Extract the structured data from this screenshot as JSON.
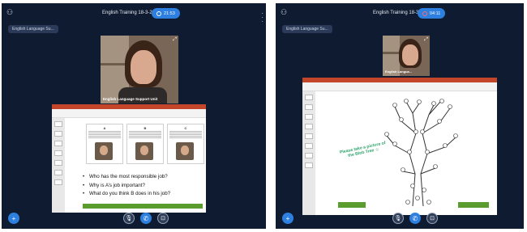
{
  "left": {
    "title": "English Training 18-3-2021",
    "timer": "21:53",
    "chip": "English Language Su...",
    "video_caption": "English Language Support Unit",
    "slide": {
      "cards": [
        {
          "letter": "A"
        },
        {
          "letter": "B"
        },
        {
          "letter": "C"
        }
      ],
      "bullets": [
        "Who has the most responsible job?",
        "Why is A’s job important?",
        "What do you think B does in his job?"
      ]
    }
  },
  "right": {
    "title": "English Training 18-3-2021",
    "timer": "04:11",
    "chip": "English Language Su...",
    "video_caption": "English Langua...",
    "slide": {
      "tree_text_1": "Please take a picture of",
      "tree_text_2": "the Blob Tree ☺"
    }
  },
  "icons": {
    "people": "people-icon",
    "add": "add-icon",
    "mic": "mic-icon",
    "phone": "phone-icon",
    "camera": "camera-icon",
    "glyphs": {
      "add": "+",
      "mic": "🎙",
      "phone": "✆",
      "camera": "⊡",
      "people": "⚇",
      "expand": "⤢"
    }
  },
  "colors": {
    "panel_bg": "#0f1b30",
    "accent_blue": "#2d7fe0",
    "slide_green": "#5a9c2e",
    "ribbon_red": "#c3462b"
  }
}
